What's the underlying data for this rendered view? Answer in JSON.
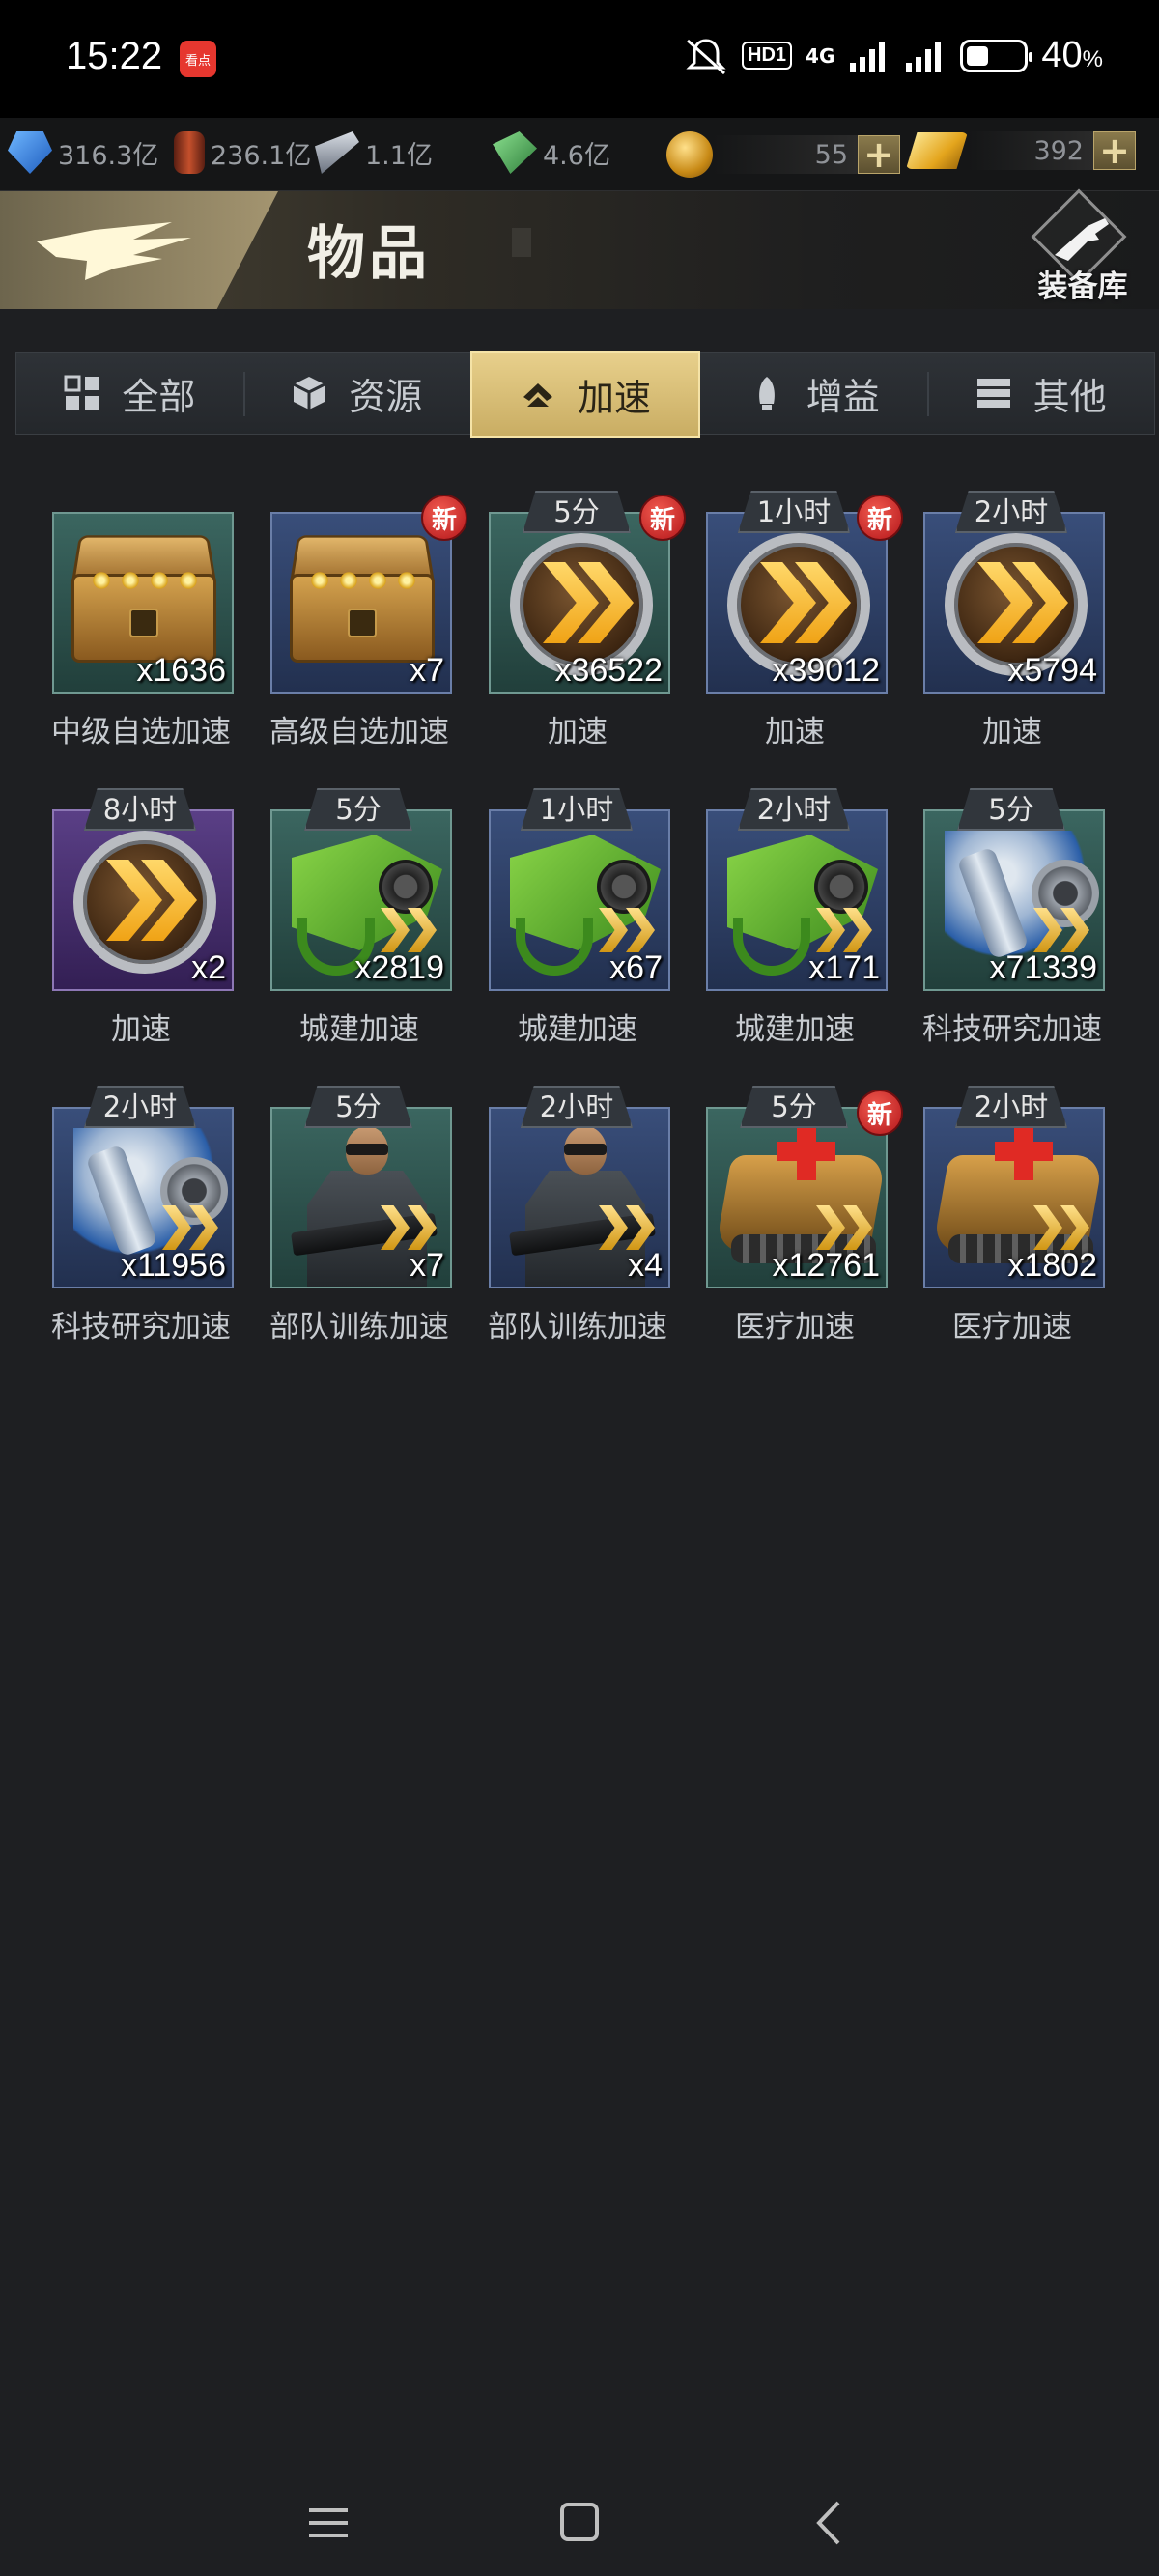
{
  "status_bar": {
    "time": "15:22",
    "app_badge": "看点",
    "hd_label": "HD1",
    "signal_label": "4G",
    "battery_percent_text": "40",
    "battery_percent_symbol": "%",
    "battery_level": 0.4
  },
  "resources": {
    "crystal": "316.3亿",
    "oil": "236.1亿",
    "steel": "1.1亿",
    "alloy": "4.6亿",
    "coin": "55",
    "gold": "392"
  },
  "header": {
    "title": "物品",
    "armory_label": "装备库"
  },
  "tabs": [
    {
      "label": "全部",
      "icon": "grid-icon"
    },
    {
      "label": "资源",
      "icon": "cube-icon"
    },
    {
      "label": "加速",
      "icon": "chevron-up-icon",
      "active": true
    },
    {
      "label": "增益",
      "icon": "rocket-icon"
    },
    {
      "label": "其他",
      "icon": "stack-icon"
    }
  ],
  "new_badge_label": "新",
  "items": [
    {
      "name": "中级自选加速",
      "count": "x1636",
      "timer": "",
      "new": false,
      "art": "chest",
      "bg": "green"
    },
    {
      "name": "高级自选加速",
      "count": "x7",
      "timer": "",
      "new": true,
      "art": "chest",
      "bg": "blue"
    },
    {
      "name": "加速",
      "count": "x36522",
      "timer": "5分",
      "new": true,
      "art": "speed",
      "bg": "green"
    },
    {
      "name": "加速",
      "count": "x39012",
      "timer": "1小时",
      "new": true,
      "art": "speed",
      "bg": "blue"
    },
    {
      "name": "加速",
      "count": "x5794",
      "timer": "2小时",
      "new": false,
      "art": "speed",
      "bg": "blue"
    },
    {
      "name": "加速",
      "count": "x2",
      "timer": "8小时",
      "new": false,
      "art": "speed",
      "bg": "purple"
    },
    {
      "name": "城建加速",
      "count": "x2819",
      "timer": "5分",
      "new": false,
      "art": "claw",
      "bg": "green"
    },
    {
      "name": "城建加速",
      "count": "x67",
      "timer": "1小时",
      "new": false,
      "art": "claw",
      "bg": "blue"
    },
    {
      "name": "城建加速",
      "count": "x171",
      "timer": "2小时",
      "new": false,
      "art": "claw",
      "bg": "blue"
    },
    {
      "name": "科技研究加速",
      "count": "x71339",
      "timer": "5分",
      "new": false,
      "art": "micro",
      "bg": "green"
    },
    {
      "name": "科技研究加速",
      "count": "x11956",
      "timer": "2小时",
      "new": false,
      "art": "micro",
      "bg": "blue"
    },
    {
      "name": "部队训练加速",
      "count": "x7",
      "timer": "5分",
      "new": false,
      "art": "soldier",
      "bg": "green"
    },
    {
      "name": "部队训练加速",
      "count": "x4",
      "timer": "2小时",
      "new": false,
      "art": "soldier",
      "bg": "blue"
    },
    {
      "name": "医疗加速",
      "count": "x12761",
      "timer": "5分",
      "new": true,
      "art": "medic",
      "bg": "green"
    },
    {
      "name": "医疗加速",
      "count": "x1802",
      "timer": "2小时",
      "new": false,
      "art": "medic",
      "bg": "blue"
    }
  ],
  "navbar": {
    "menu_icon": "menu-icon",
    "home_icon": "home-square-icon",
    "back_icon": "back-chevron-icon"
  }
}
